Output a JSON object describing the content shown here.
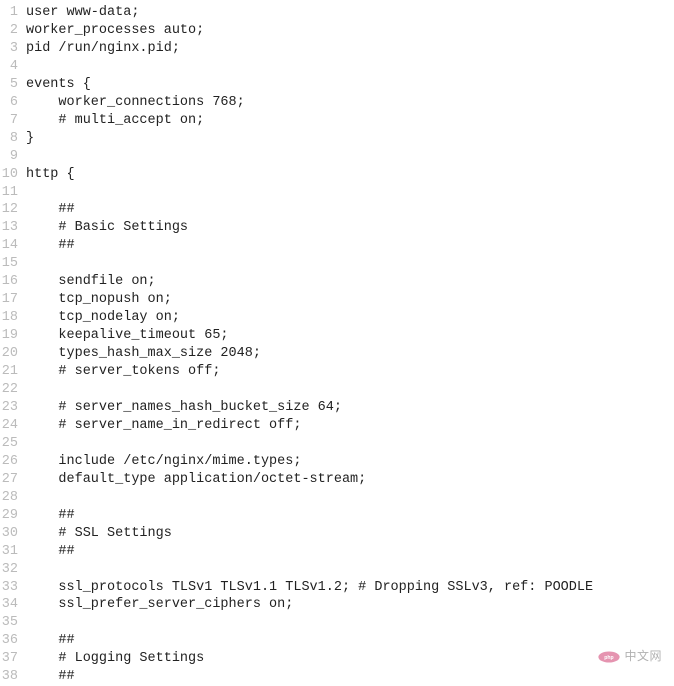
{
  "lines": [
    {
      "num": "1",
      "text": "user www-data;"
    },
    {
      "num": "2",
      "text": "worker_processes auto;"
    },
    {
      "num": "3",
      "text": "pid /run/nginx.pid;"
    },
    {
      "num": "4",
      "text": ""
    },
    {
      "num": "5",
      "text": "events {"
    },
    {
      "num": "6",
      "text": "    worker_connections 768;"
    },
    {
      "num": "7",
      "text": "    # multi_accept on;"
    },
    {
      "num": "8",
      "text": "}"
    },
    {
      "num": "9",
      "text": ""
    },
    {
      "num": "10",
      "text": "http {"
    },
    {
      "num": "11",
      "text": ""
    },
    {
      "num": "12",
      "text": "    ##"
    },
    {
      "num": "13",
      "text": "    # Basic Settings"
    },
    {
      "num": "14",
      "text": "    ##"
    },
    {
      "num": "15",
      "text": ""
    },
    {
      "num": "16",
      "text": "    sendfile on;"
    },
    {
      "num": "17",
      "text": "    tcp_nopush on;"
    },
    {
      "num": "18",
      "text": "    tcp_nodelay on;"
    },
    {
      "num": "19",
      "text": "    keepalive_timeout 65;"
    },
    {
      "num": "20",
      "text": "    types_hash_max_size 2048;"
    },
    {
      "num": "21",
      "text": "    # server_tokens off;"
    },
    {
      "num": "22",
      "text": ""
    },
    {
      "num": "23",
      "text": "    # server_names_hash_bucket_size 64;"
    },
    {
      "num": "24",
      "text": "    # server_name_in_redirect off;"
    },
    {
      "num": "25",
      "text": ""
    },
    {
      "num": "26",
      "text": "    include /etc/nginx/mime.types;"
    },
    {
      "num": "27",
      "text": "    default_type application/octet-stream;"
    },
    {
      "num": "28",
      "text": ""
    },
    {
      "num": "29",
      "text": "    ##"
    },
    {
      "num": "30",
      "text": "    # SSL Settings"
    },
    {
      "num": "31",
      "text": "    ##"
    },
    {
      "num": "32",
      "text": ""
    },
    {
      "num": "33",
      "text": "    ssl_protocols TLSv1 TLSv1.1 TLSv1.2; # Dropping SSLv3, ref: POODLE"
    },
    {
      "num": "34",
      "text": "    ssl_prefer_server_ciphers on;"
    },
    {
      "num": "35",
      "text": ""
    },
    {
      "num": "36",
      "text": "    ##"
    },
    {
      "num": "37",
      "text": "    # Logging Settings"
    },
    {
      "num": "38",
      "text": "    ##"
    }
  ],
  "watermark": {
    "text": "中文网"
  }
}
